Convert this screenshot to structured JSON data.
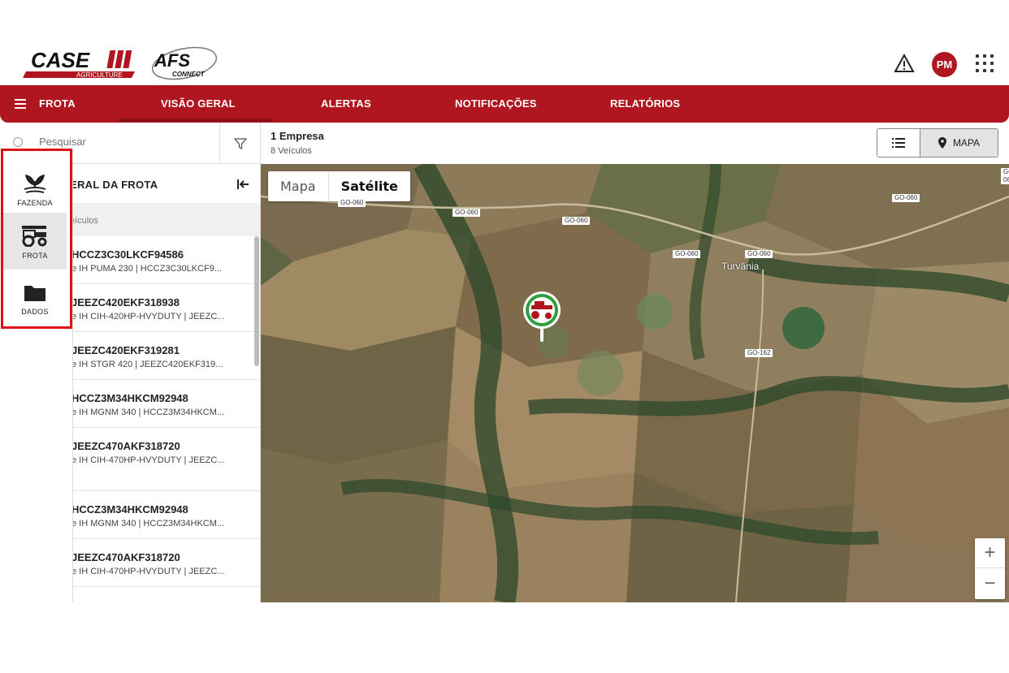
{
  "header": {
    "logo_case": "CASE",
    "logo_agriculture": "AGRICULTURE",
    "logo_afs": "AFS",
    "logo_connect": "CONNECT",
    "avatar_initials": "PM"
  },
  "nav": {
    "brand": "FROTA",
    "tabs": [
      {
        "label": "VISÃO GERAL",
        "active": true
      },
      {
        "label": "ALERTAS"
      },
      {
        "label": "NOTIFICAÇÕES"
      },
      {
        "label": "RELATÓRIOS"
      }
    ]
  },
  "search": {
    "placeholder": "Pesquisar"
  },
  "summary": {
    "companies": "1 Empresa",
    "vehicles": "8 Veículos"
  },
  "view_toggle": {
    "map_label": "MAPA"
  },
  "rail": {
    "items": [
      {
        "label": "FAZENDA"
      },
      {
        "label": "FROTA",
        "active": true
      },
      {
        "label": "DADOS"
      }
    ],
    "highlight_color": "#e0101a"
  },
  "panel": {
    "title": "ERAL DA FROTA",
    "subtitle": "eículos",
    "vehicles": [
      {
        "id": "HCCZ3C30LKCF94586",
        "desc": "e IH PUMA 230 | HCCZ3C30LKCF9..."
      },
      {
        "id": "JEEZC420EKF318938",
        "desc": "e IH CIH-420HP-HVYDUTY | JEEZC..."
      },
      {
        "id": "JEEZC420EKF319281",
        "desc": "e IH STGR 420 | JEEZC420EKF319..."
      },
      {
        "id": "HCCZ3M34HKCM92948",
        "desc": "e IH MGNM 340 | HCCZ3M34HKCM..."
      },
      {
        "id": "JEEZC470AKF318720",
        "desc": "e IH CIH-470HP-HVYDUTY | JEEZC..."
      },
      {
        "id": "HCCZ3M34HKCM92948",
        "desc": "e IH MGNM 340 | HCCZ3M34HKCM..."
      },
      {
        "id": "JEEZC470AKF318720",
        "desc": "e IH CIH-470HP-HVYDUTY | JEEZC..."
      }
    ]
  },
  "map": {
    "type_options": [
      "Mapa",
      "Satélite"
    ],
    "selected_type": "Satélite",
    "town": "Turvânia",
    "roads": [
      "GO-060",
      "GO-060",
      "GO-060",
      "GO-060",
      "GO-060",
      "GO-060",
      "GO-060",
      "GO-162"
    ],
    "zoom_in": "+",
    "zoom_out": "−"
  },
  "colors": {
    "brand_red": "#b0161f",
    "marker_green": "#2e9e3e"
  }
}
